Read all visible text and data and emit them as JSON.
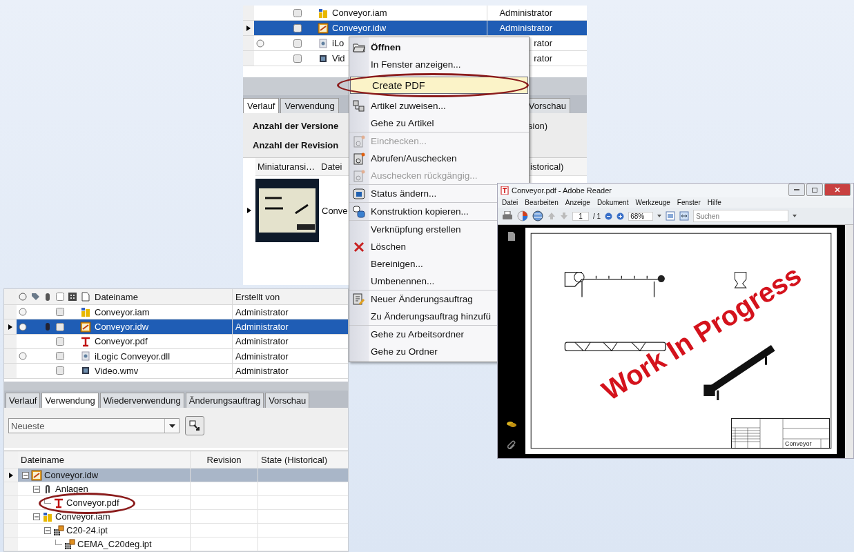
{
  "vault_window": {
    "rows": [
      {
        "kind": "iam",
        "name": "Conveyor.iam",
        "creator": "Administrator",
        "status": false,
        "selected": false
      },
      {
        "kind": "idw",
        "name": "Conveyor.idw",
        "creator": "Administrator",
        "status": false,
        "selected": true
      },
      {
        "kind": "dll",
        "name": "iLo",
        "creator": "rator",
        "status": true,
        "selected": false
      },
      {
        "kind": "wmv",
        "name": "Vid",
        "creator": "rator",
        "status": false,
        "selected": false
      }
    ],
    "tabs": [
      {
        "label": "Verlauf",
        "selected": true
      },
      {
        "label": "Verwendung",
        "selected": false
      },
      {
        "label": "Vorschau",
        "selected": false
      }
    ],
    "info": [
      {
        "label": "Anzahl der Versione",
        "value": "sion)"
      },
      {
        "label": "Anzahl der Revision"
      }
    ],
    "columns": [
      "Miniaturansi…",
      "Datei",
      "istorical)"
    ],
    "thumb_row": {
      "name": "Conve"
    }
  },
  "context_menu": {
    "groups": [
      {
        "items": [
          {
            "label": "Öffnen",
            "default": true,
            "disabled": false,
            "selected": false,
            "circled": false
          },
          {
            "label": "In Fenster anzeigen...",
            "default": false,
            "disabled": false,
            "selected": false,
            "circled": false
          },
          {
            "label": "Create PDF",
            "default": false,
            "disabled": false,
            "selected": true,
            "circled": true
          },
          {
            "label": "Artikel zuweisen...",
            "default": false,
            "disabled": false,
            "selected": false,
            "circled": false
          },
          {
            "label": "Gehe zu Artikel",
            "default": false,
            "disabled": false,
            "selected": false,
            "circled": false
          }
        ]
      },
      {
        "items": [
          {
            "label": "Einchecken...",
            "default": false,
            "disabled": true,
            "selected": false,
            "circled": false
          },
          {
            "label": "Abrufen/Auschecken",
            "default": false,
            "disabled": false,
            "selected": false,
            "circled": false
          },
          {
            "label": "Auschecken rückgängig...",
            "default": false,
            "disabled": true,
            "selected": false,
            "circled": false
          }
        ]
      },
      {
        "items": [
          {
            "label": "Status ändern...",
            "default": false,
            "disabled": false,
            "selected": false,
            "circled": false
          }
        ]
      },
      {
        "items": [
          {
            "label": "Konstruktion kopieren...",
            "default": false,
            "disabled": false,
            "selected": false,
            "circled": false
          }
        ]
      },
      {
        "items": [
          {
            "label": "Verknüpfung erstellen",
            "default": false,
            "disabled": false,
            "selected": false,
            "circled": false
          },
          {
            "label": "Löschen",
            "default": false,
            "disabled": false,
            "selected": false,
            "circled": false
          },
          {
            "label": "Bereinigen...",
            "default": false,
            "disabled": false,
            "selected": false,
            "circled": false
          },
          {
            "label": "Umbenennen...",
            "default": false,
            "disabled": false,
            "selected": false,
            "circled": false
          }
        ]
      },
      {
        "items": [
          {
            "label": "Neuer Änderungsauftrag",
            "default": false,
            "disabled": false,
            "selected": false,
            "circled": false
          },
          {
            "label": "Zu Änderungsauftrag hinzufü",
            "default": false,
            "disabled": false,
            "selected": false,
            "circled": false
          }
        ]
      },
      {
        "items": [
          {
            "label": "Gehe zu Arbeitsordner",
            "default": false,
            "disabled": false,
            "selected": false,
            "circled": false
          },
          {
            "label": "Gehe zu Ordner",
            "default": false,
            "disabled": false,
            "selected": false,
            "circled": false
          }
        ]
      }
    ]
  },
  "usage_window": {
    "columns": [
      "Dateiname",
      "Erstellt von"
    ],
    "rows": [
      {
        "kind": "iam",
        "name": "Conveyor.iam",
        "creator": "Administrator",
        "status": true,
        "attachment": false,
        "selected": false
      },
      {
        "kind": "idw",
        "name": "Conveyor.idw",
        "creator": "Administrator",
        "status": true,
        "attachment": true,
        "selected": true
      },
      {
        "kind": "pdf",
        "name": "Conveyor.pdf",
        "creator": "Administrator",
        "status": false,
        "attachment": false,
        "selected": false
      },
      {
        "kind": "dll",
        "name": "iLogic Conveyor.dll",
        "creator": "Administrator",
        "status": true,
        "attachment": false,
        "selected": false
      },
      {
        "kind": "wmv",
        "name": "Video.wmv",
        "creator": "Administrator",
        "status": false,
        "attachment": false,
        "selected": false
      }
    ],
    "tabs": [
      {
        "label": "Verlauf",
        "selected": false
      },
      {
        "label": "Verwendung",
        "selected": true
      },
      {
        "label": "Wiederverwendung",
        "selected": false
      },
      {
        "label": "Änderungsauftrag",
        "selected": false
      },
      {
        "label": "Vorschau",
        "selected": false
      }
    ],
    "filter": {
      "value": "Neueste"
    },
    "tree": {
      "columns": [
        "Dateiname",
        "Revision",
        "State (Historical)"
      ],
      "items": [
        {
          "kind": "idw",
          "name": "Conveyor.idw",
          "selected": true,
          "circled": false,
          "expanded": true,
          "children": [
            {
              "kind": "attachments",
              "name": "Anlagen",
              "selected": false,
              "circled": false,
              "expanded": true,
              "children": [
                {
                  "kind": "pdf",
                  "name": "Conveyor.pdf",
                  "selected": false,
                  "circled": true
                }
              ]
            },
            {
              "kind": "iam",
              "name": "Conveyor.iam",
              "selected": false,
              "circled": false,
              "expanded": true,
              "children": [
                {
                  "kind": "ipt",
                  "name": "C20-24.ipt",
                  "selected": false,
                  "circled": false,
                  "expanded": true,
                  "children": [
                    {
                      "kind": "ipt",
                      "name": "CEMA_C20deg.ipt",
                      "selected": false,
                      "circled": false
                    }
                  ]
                }
              ]
            }
          ]
        }
      ]
    }
  },
  "reader_window": {
    "title": "Conveyor.pdf - Adobe Reader",
    "menu": [
      "Datei",
      "Bearbeiten",
      "Anzeige",
      "Dokument",
      "Werkzeuge",
      "Fenster",
      "Hilfe"
    ],
    "page": "1",
    "page_total": "/ 1",
    "zoom": "68%",
    "search": {
      "placeholder": "Suchen"
    },
    "stamp": "Work In Progress",
    "title_block": "Conveyor"
  }
}
